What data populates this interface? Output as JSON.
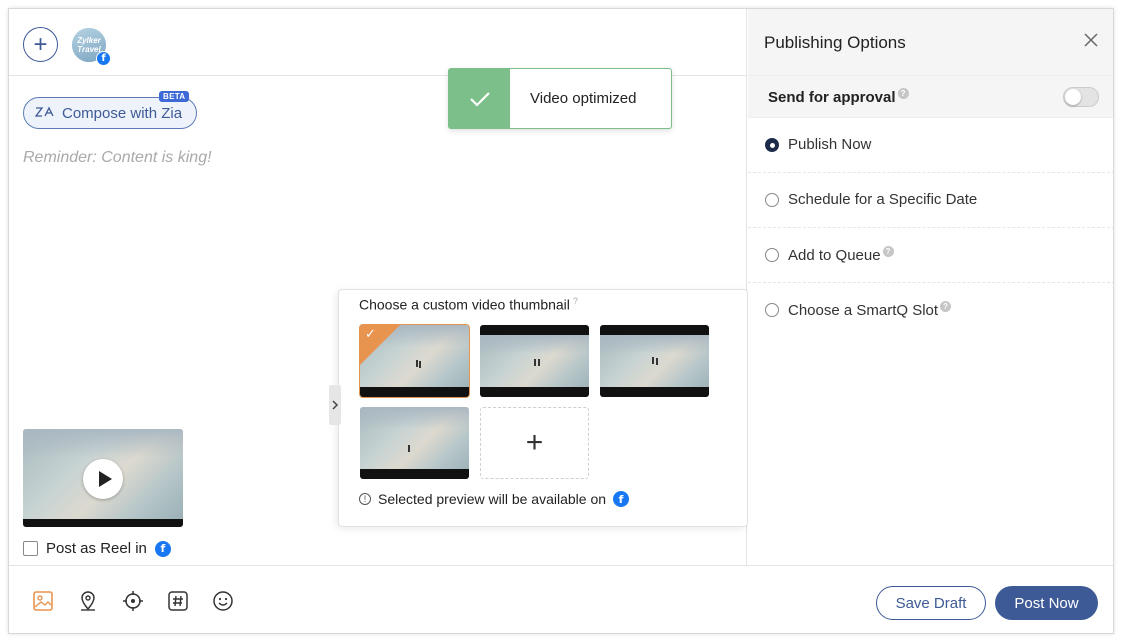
{
  "composer": {
    "add_symbol": "+",
    "avatar_lines": [
      "Zylker",
      "Travel"
    ],
    "facebook_glyph": "f",
    "zia": {
      "label": "Compose with Zia",
      "badge": "BETA",
      "icon": "zia-icon"
    },
    "placeholder": "Reminder: Content is king!"
  },
  "toast": {
    "message": "Video optimized",
    "icon": "checkmark-icon",
    "color": "#7cbf8a"
  },
  "video": {
    "post_as_reel_label": "Post as Reel in"
  },
  "thumbnail_chooser": {
    "title": "Choose a custom video thumbnail",
    "help_mark": "?",
    "add_symbol": "+",
    "note": "Selected preview will be available on",
    "selected_index": 0,
    "thumbnail_count": 4
  },
  "publishing": {
    "title": "Publishing Options",
    "close_icon": "close-icon",
    "send_for_approval": {
      "label": "Send for approval",
      "enabled": false
    },
    "options": [
      {
        "label": "Publish Now",
        "selected": true,
        "help": false
      },
      {
        "label": "Schedule for a Specific Date",
        "selected": false,
        "help": false
      },
      {
        "label": "Add to Queue",
        "selected": false,
        "help": true
      },
      {
        "label": "Choose a SmartQ Slot",
        "selected": false,
        "help": true
      }
    ]
  },
  "toolbar": {
    "icons": [
      "image-icon",
      "location-pin-icon",
      "target-icon",
      "hashtag-icon",
      "emoji-icon"
    ],
    "save_draft_label": "Save Draft",
    "post_now_label": "Post Now"
  },
  "colors": {
    "primary": "#3d5a96",
    "accent": "#e8944f",
    "success": "#7cbf8a",
    "facebook": "#1877f2"
  }
}
